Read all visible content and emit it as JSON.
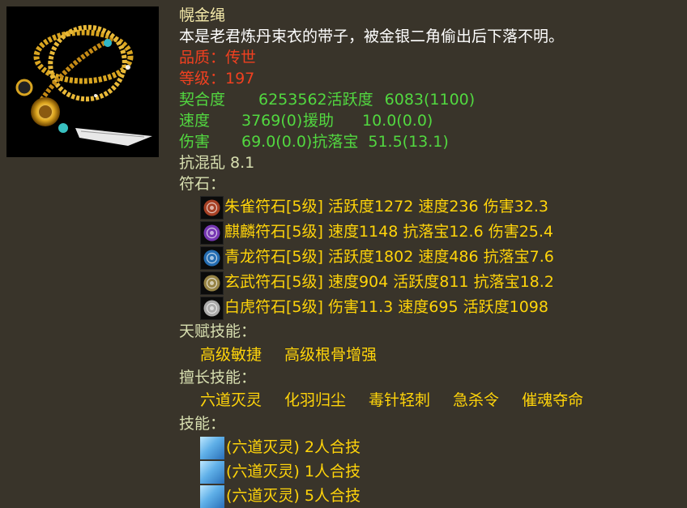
{
  "item": {
    "name": "幌金绳",
    "description": "本是老君炼丹束衣的带子，被金银二角偷出后下落不明。",
    "quality_label": "品质：传世",
    "level_label": "等级：197"
  },
  "stats": {
    "row1": {
      "k1": "契合度",
      "v1": "6253562",
      "k2": "活跃度",
      "v2": "6083(1100)"
    },
    "row2": {
      "k1": "速度",
      "v1": "3769(0)",
      "k2": "援助",
      "v2": "10.0(0.0)"
    },
    "row3": {
      "k1": "伤害",
      "v1": "69.0(0.0)",
      "k2": "抗落宝",
      "v2": "51.5(13.1)"
    },
    "resist_chaos": "抗混乱 8.1"
  },
  "runes": {
    "header": "符石：",
    "items": [
      {
        "text": "朱雀符石[5级] 活跃度1272 速度236 伤害32.3",
        "icon": "vermilion-bird-rune-icon",
        "color": "#c24a2a"
      },
      {
        "text": "麒麟符石[5级] 速度1148 抗落宝12.6 伤害25.4",
        "icon": "qilin-rune-icon",
        "color": "#8a3fd0"
      },
      {
        "text": "青龙符石[5级] 活跃度1802 速度486 抗落宝7.6",
        "icon": "azure-dragon-rune-icon",
        "color": "#2a7fd0"
      },
      {
        "text": "玄武符石[5级] 速度904 活跃度811 抗落宝18.2",
        "icon": "black-tortoise-rune-icon",
        "color": "#b09a50"
      },
      {
        "text": "白虎符石[5级] 伤害11.3 速度695 活跃度1098",
        "icon": "white-tiger-rune-icon",
        "color": "#c8c8c8"
      }
    ]
  },
  "talents": {
    "header": "天赋技能：",
    "items": [
      "高级敏捷",
      "高级根骨增强"
    ]
  },
  "specialties": {
    "header": "擅长技能：",
    "items": [
      "六道灭灵",
      "化羽归尘",
      "毒针轻刺",
      "急杀令",
      "催魂夺命"
    ]
  },
  "skills": {
    "header": "技能：",
    "items": [
      "(六道灭灵) 2人合技",
      "(六道灭灵) 1人合技",
      "(六道灭灵) 5人合技"
    ]
  }
}
